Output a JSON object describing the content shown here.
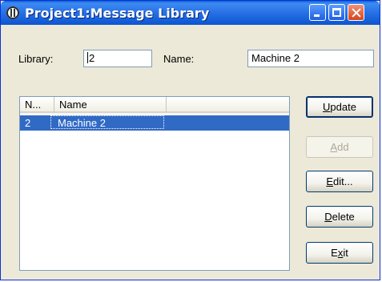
{
  "window": {
    "title": "Project1:Message Library"
  },
  "form": {
    "library_label": "Library:",
    "library_value": "2",
    "name_label": "Name:",
    "name_value": "Machine 2"
  },
  "list": {
    "columns": [
      "N...",
      "Name",
      ""
    ],
    "rows": [
      {
        "number": "2",
        "name": "Machine 2",
        "selected": true
      }
    ]
  },
  "buttons": {
    "update": {
      "pre": "",
      "mnemonic": "U",
      "post": "pdate",
      "enabled": true
    },
    "add": {
      "pre": "",
      "mnemonic": "A",
      "post": "dd",
      "enabled": false
    },
    "edit": {
      "pre": "",
      "mnemonic": "E",
      "post": "dit...",
      "enabled": true
    },
    "delete": {
      "pre": "",
      "mnemonic": "D",
      "post": "elete",
      "enabled": true
    },
    "exit": {
      "pre": "E",
      "mnemonic": "x",
      "post": "it",
      "enabled": true
    }
  },
  "colors": {
    "titlebar": "#0b55d0",
    "selection": "#316ac5",
    "face": "#ece9d8"
  },
  "icons": {
    "app": "app-icon",
    "minimize": "minimize-icon",
    "maximize": "maximize-icon",
    "close": "close-icon"
  }
}
